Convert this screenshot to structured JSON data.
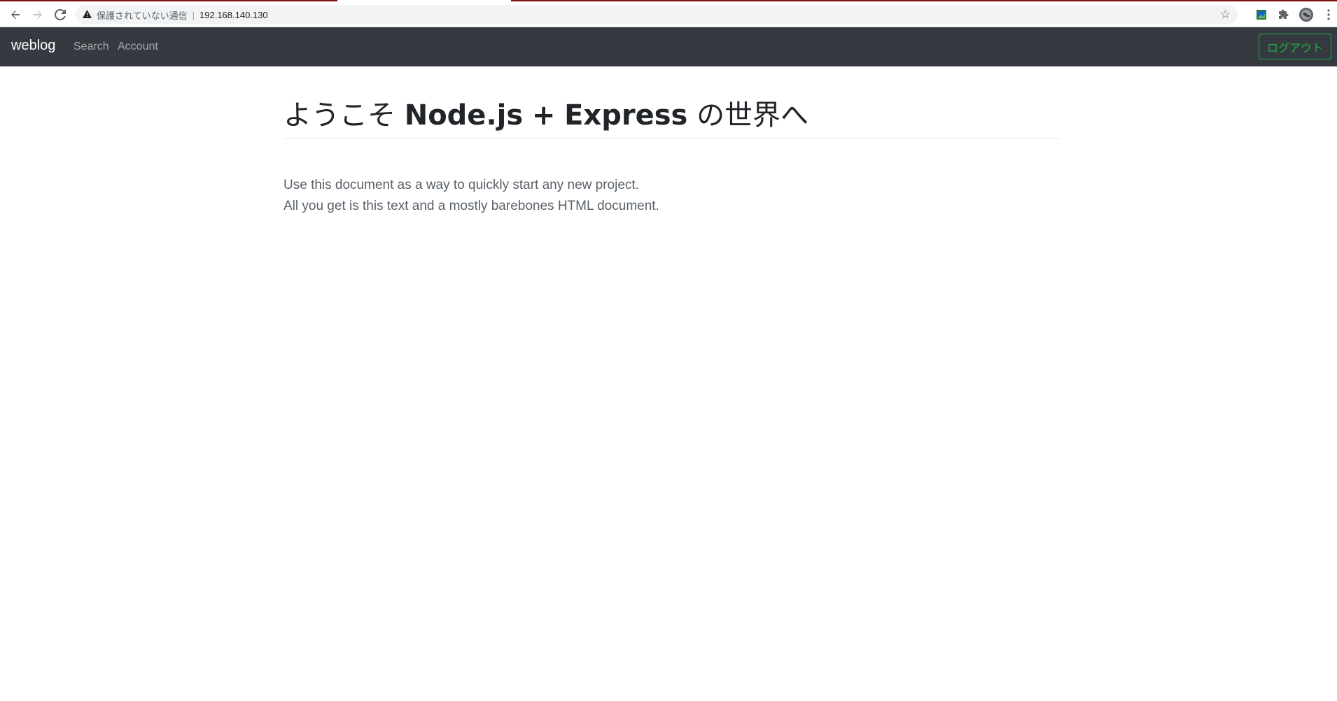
{
  "browser": {
    "security_label": "保護されていない通信",
    "separator": "|",
    "url": "192.168.140.130"
  },
  "navbar": {
    "brand": "weblog",
    "links": [
      {
        "label": "Search"
      },
      {
        "label": "Account"
      }
    ],
    "logout_label": "ログアウト"
  },
  "main": {
    "title_prefix": "ようこそ",
    "title_bold_1": "Node.js",
    "title_plus": "+",
    "title_bold_2": "Express",
    "title_suffix": "の世界へ",
    "lead_lines": [
      "Use this document as a way to quickly start any new project.",
      "All you get is this text and a mostly barebones HTML document."
    ]
  },
  "colors": {
    "navbar_bg": "#343a40",
    "logout_accent": "#28a745"
  }
}
